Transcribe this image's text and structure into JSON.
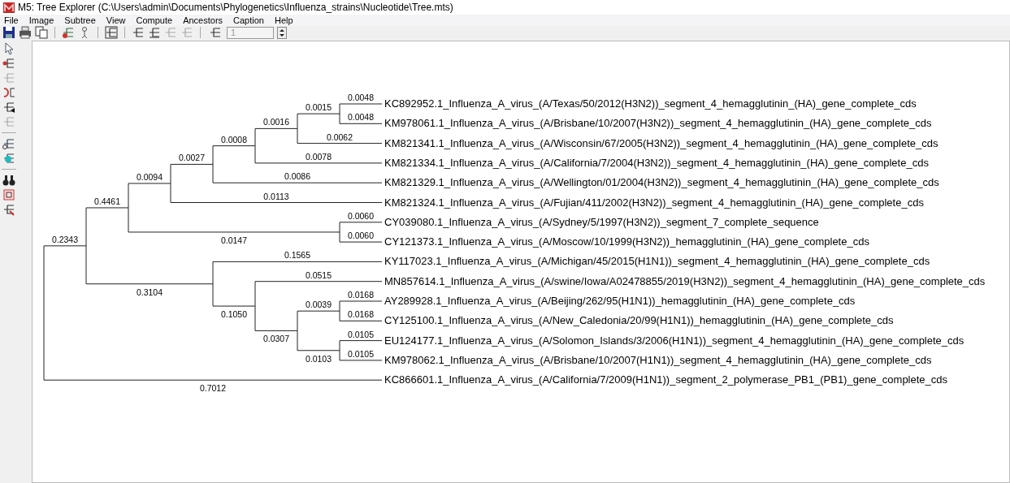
{
  "window": {
    "title": "M5: Tree Explorer (C:\\Users\\admin\\Documents\\Phylogenetics\\Influenza_strains\\Nucleotide\\Tree.mts)"
  },
  "menu": [
    "File",
    "Image",
    "Subtree",
    "View",
    "Compute",
    "Ancestors",
    "Caption",
    "Help"
  ],
  "toolbar": {
    "spin_field": {
      "value": "1",
      "disabled": true
    }
  },
  "tree": {
    "children": [
      {
        "branch_length": "0.2343",
        "children": [
          {
            "branch_length": "0.4461",
            "children": [
              {
                "branch_length": "0.0094",
                "children": [
                  {
                    "branch_length": "0.0027",
                    "children": [
                      {
                        "branch_length": "0.0008",
                        "children": [
                          {
                            "branch_length": "0.0016",
                            "children": [
                              {
                                "branch_length": "0.0015",
                                "children": [
                                  {
                                    "branch_length": "0.0048",
                                    "name": "KC892952.1_Influenza_A_virus_(A/Texas/50/2012(H3N2))_segment_4_hemagglutinin_(HA)_gene_complete_cds"
                                  },
                                  {
                                    "branch_length": "0.0048",
                                    "name": "KM978061.1_Influenza_A_virus_(A/Brisbane/10/2007(H3N2))_segment_4_hemagglutinin_(HA)_gene_complete_cds"
                                  }
                                ]
                              },
                              {
                                "branch_length": "0.0062",
                                "name": "KM821341.1_Influenza_A_virus_(A/Wisconsin/67/2005(H3N2))_segment_4_hemagglutinin_(HA)_gene_complete_cds"
                              }
                            ]
                          },
                          {
                            "branch_length": "0.0078",
                            "name": "KM821334.1_Influenza_A_virus_(A/California/7/2004(H3N2))_segment_4_hemagglutinin_(HA)_gene_complete_cds"
                          }
                        ]
                      },
                      {
                        "branch_length": "0.0086",
                        "name": "KM821329.1_Influenza_A_virus_(A/Wellington/01/2004(H3N2))_segment_4_hemagglutinin_(HA)_gene_complete_cds"
                      }
                    ]
                  },
                  {
                    "branch_length": "0.0113",
                    "name": "KM821324.1_Influenza_A_virus_(A/Fujian/411/2002(H3N2))_segment_4_hemagglutinin_(HA)_gene_complete_cds"
                  }
                ]
              },
              {
                "branch_length": "0.0147",
                "children": [
                  {
                    "branch_length": "0.0060",
                    "name": "CY039080.1_Influenza_A_virus_(A/Sydney/5/1997(H3N2))_segment_7_complete_sequence"
                  },
                  {
                    "branch_length": "0.0060",
                    "name": "CY121373.1_Influenza_A_virus_(A/Moscow/10/1999(H3N2))_hemagglutinin_(HA)_gene_complete_cds"
                  }
                ]
              }
            ]
          },
          {
            "branch_length": "0.3104",
            "children": [
              {
                "branch_length": "0.1565",
                "name": "KY117023.1_Influenza_A_virus_(A/Michigan/45/2015(H1N1))_segment_4_hemagglutinin_(HA)_gene_complete_cds"
              },
              {
                "branch_length": "0.1050",
                "children": [
                  {
                    "branch_length": "0.0515",
                    "name": "MN857614.1_Influenza_A_virus_(A/swine/Iowa/A02478855/2019(H3N2))_segment_4_hemagglutinin_(HA)_gene_complete_cds"
                  },
                  {
                    "branch_length": "0.0307",
                    "children": [
                      {
                        "branch_length": "0.0039",
                        "children": [
                          {
                            "branch_length": "0.0168",
                            "name": "AY289928.1_Influenza_A_virus_(A/Beijing/262/95(H1N1))_hemagglutinin_(HA)_gene_complete_cds"
                          },
                          {
                            "branch_length": "0.0168",
                            "name": "CY125100.1_Influenza_A_virus_(A/New_Caledonia/20/99(H1N1))_hemagglutinin_(HA)_gene_complete_cds"
                          }
                        ]
                      },
                      {
                        "branch_length": "0.0103",
                        "children": [
                          {
                            "branch_length": "0.0105",
                            "name": "EU124177.1_Influenza_A_virus_(A/Solomon_Islands/3/2006(H1N1))_segment_4_hemagglutinin_(HA)_gene_complete_cds"
                          },
                          {
                            "branch_length": "0.0105",
                            "name": "KM978062.1_Influenza_A_virus_(A/Brisbane/10/2007(H1N1))_segment_4_hemagglutinin_(HA)_gene_complete_cds"
                          }
                        ]
                      }
                    ]
                  }
                ]
              }
            ]
          }
        ]
      },
      {
        "branch_length": "0.7012",
        "name": "KC866601.1_Influenza_A_virus_(A/California/7/2009(H1N1))_segment_2_polymerase_PB1_(PB1)_gene_complete_cds"
      }
    ]
  }
}
